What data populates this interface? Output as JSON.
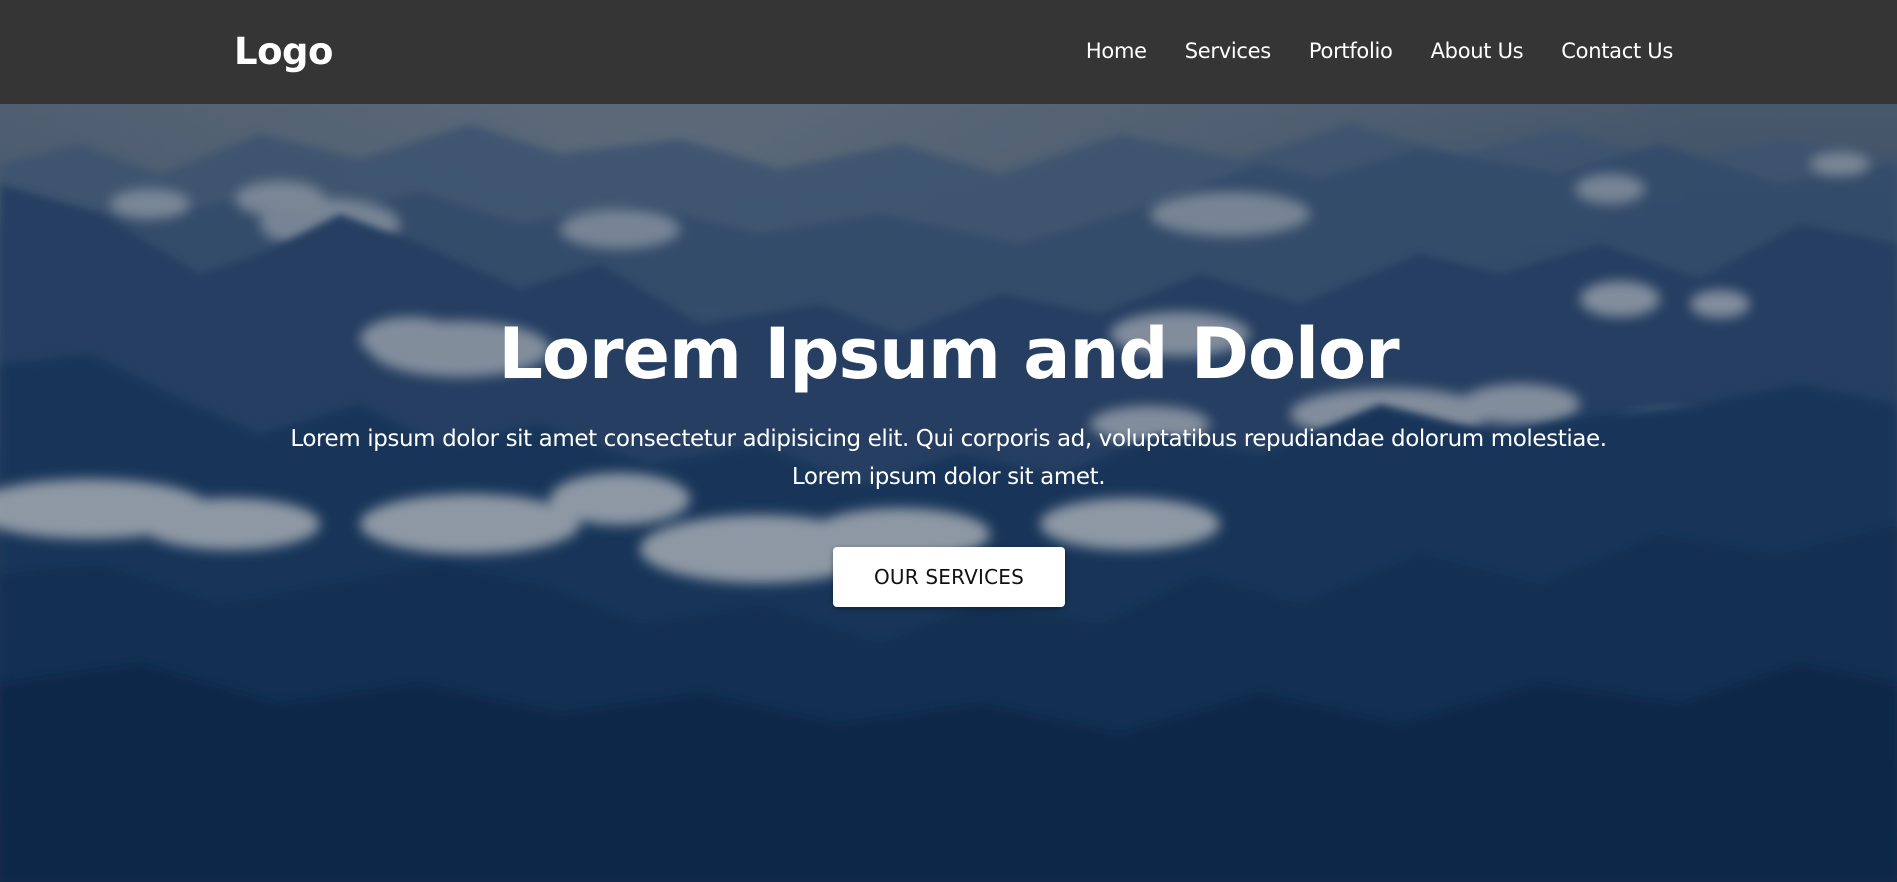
{
  "header": {
    "logo": "Logo",
    "nav": [
      {
        "label": "Home"
      },
      {
        "label": "Services"
      },
      {
        "label": "Portfolio"
      },
      {
        "label": "About Us"
      },
      {
        "label": "Contact Us"
      }
    ]
  },
  "hero": {
    "title": "Lorem Ipsum and Dolor",
    "text_line1": "Lorem ipsum dolor sit amet consectetur adipisicing elit. Qui corporis ad, voluptatibus repudiandae dolorum molestiae.",
    "text_line2": "Lorem ipsum dolor sit amet.",
    "cta_label": "OUR SERVICES",
    "background_icon": "mountain-clouds-landscape-image"
  },
  "colors": {
    "header_bg": "#353535",
    "hero_overlay": "#0f2e52",
    "text": "#ffffff",
    "button_bg": "#ffffff",
    "button_text": "#111111"
  }
}
